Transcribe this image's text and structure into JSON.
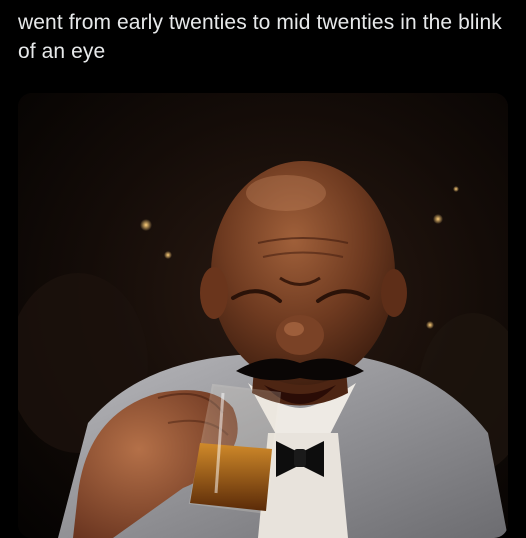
{
  "post": {
    "caption": "went from early twenties to mid twenties in the blink of an eye"
  },
  "media": {
    "icon": "photo-meme",
    "colors": {
      "background": "#000000",
      "caption_text": "#e7e9ea",
      "suit": "#9a9a9e",
      "skin": "#6b3a22",
      "whiskey": "#8a4a12"
    }
  }
}
